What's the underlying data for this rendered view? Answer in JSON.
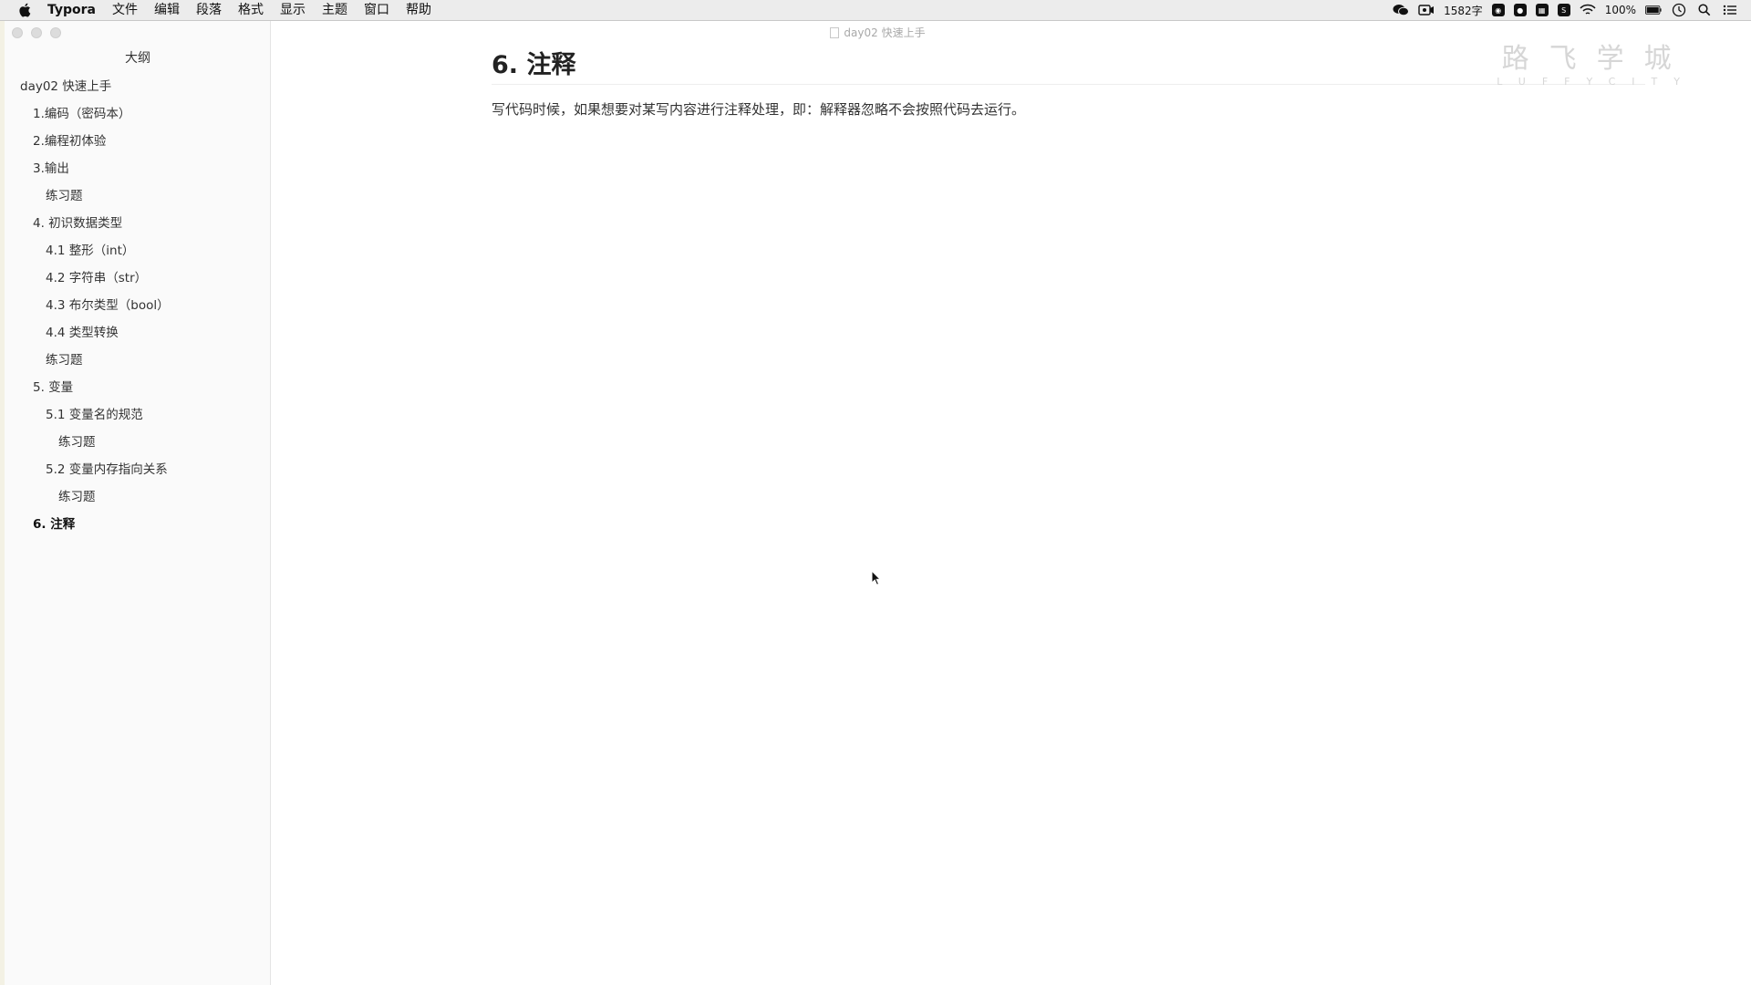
{
  "menubar": {
    "app_name": "Typora",
    "items": [
      "文件",
      "编辑",
      "段落",
      "格式",
      "显示",
      "主题",
      "窗口",
      "帮助"
    ],
    "status": {
      "word_count": "1582字",
      "battery": "100%"
    }
  },
  "window": {
    "title": "day02 快速上手"
  },
  "sidebar": {
    "header": "大纲",
    "items": [
      {
        "label": "day02 快速上手",
        "level": 1
      },
      {
        "label": "1.编码（密码本）",
        "level": 2
      },
      {
        "label": "2.编程初体验",
        "level": 2
      },
      {
        "label": "3.输出",
        "level": 2
      },
      {
        "label": "练习题",
        "level": 3
      },
      {
        "label": "4. 初识数据类型",
        "level": 2
      },
      {
        "label": "4.1 整形（int）",
        "level": 3
      },
      {
        "label": "4.2 字符串（str）",
        "level": 3
      },
      {
        "label": "4.3 布尔类型（bool）",
        "level": 3
      },
      {
        "label": "4.4 类型转换",
        "level": 3
      },
      {
        "label": "练习题",
        "level": 3
      },
      {
        "label": "5. 变量",
        "level": 2
      },
      {
        "label": "5.1 变量名的规范",
        "level": 3
      },
      {
        "label": "练习题",
        "level": 4
      },
      {
        "label": "5.2 变量内存指向关系",
        "level": 3
      },
      {
        "label": "练习题",
        "level": 4
      },
      {
        "label": "6. 注释",
        "level": 2,
        "active": true
      }
    ]
  },
  "content": {
    "heading": "6. 注释",
    "paragraph": "写代码时候，如果想要对某写内容进行注释处理，即：解释器忽略不会按照代码去运行。"
  },
  "watermark": {
    "chinese": "路飞学城",
    "english": "LUFFYCITY"
  }
}
